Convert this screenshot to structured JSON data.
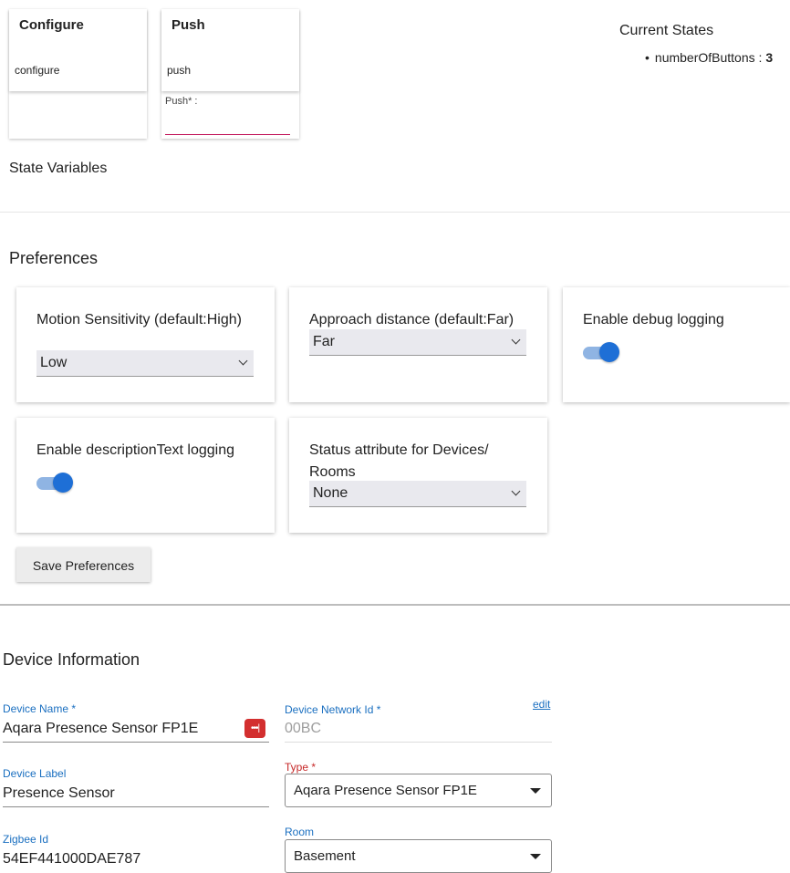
{
  "commands": [
    {
      "title": "Configure",
      "subtitle": "configure"
    },
    {
      "title": "Push",
      "subtitle": "push",
      "field_label": "Push* :"
    }
  ],
  "current_states": {
    "title": "Current States",
    "items": [
      {
        "name": "numberOfButtons",
        "separator": " : ",
        "value": "3"
      }
    ]
  },
  "state_variables_title": "State Variables",
  "preferences": {
    "title": "Preferences",
    "items": [
      {
        "label": "Motion Sensitivity (default:High)",
        "type": "select",
        "value": "Low"
      },
      {
        "label": "Approach distance (default:Far)",
        "type": "select",
        "value": "Far"
      },
      {
        "label": "Enable debug logging",
        "type": "toggle",
        "value": "on"
      },
      {
        "label": "Enable descriptionText logging",
        "type": "toggle",
        "value": "on"
      },
      {
        "label": "Status attribute for Devices/ Rooms",
        "type": "select",
        "value": "None"
      }
    ],
    "save_label": "Save Preferences"
  },
  "device_info": {
    "title": "Device Information",
    "name_label": "Device Name *",
    "name_value": "Aqara Presence Sensor FP1E",
    "network_id_label": "Device Network Id *",
    "network_id_value": "00BC",
    "edit_label": "edit",
    "label_label": "Device Label",
    "label_value": "Presence Sensor",
    "type_label": "Type *",
    "type_value": "Aqara Presence Sensor FP1E",
    "zigbee_label": "Zigbee Id",
    "zigbee_value": "54EF441000DAE787",
    "room_label": "Room",
    "room_value": "Basement"
  },
  "colors": {
    "accent": "#1e6fd6",
    "link": "#1a6fc0",
    "required": "#c62828",
    "field_underline": "#c2185b"
  },
  "icons": [
    "password-manager-icon",
    "chevron-down-icon",
    "dropdown-caret-icon"
  ]
}
